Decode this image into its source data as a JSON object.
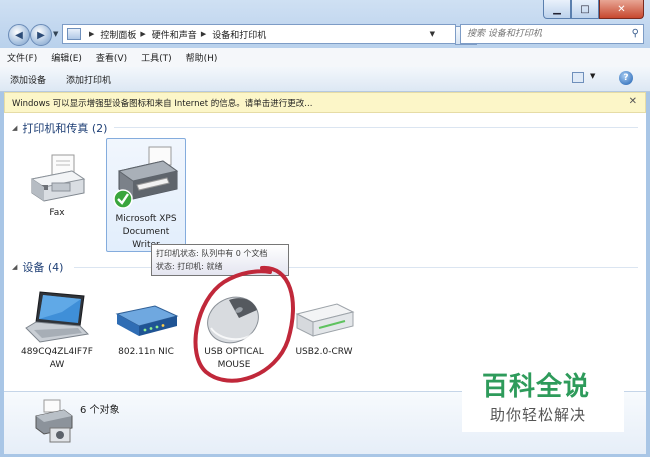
{
  "window": {
    "caption_buttons": {
      "minimize": "▁",
      "maximize": "□",
      "close": "✕"
    }
  },
  "address": {
    "crumbs": [
      "控制面板",
      "硬件和声音",
      "设备和打印机"
    ],
    "search_placeholder": "搜索 设备和打印机"
  },
  "menu": [
    "文件(F)",
    "编辑(E)",
    "查看(V)",
    "工具(T)",
    "帮助(H)"
  ],
  "toolbar": {
    "add_device": "添加设备",
    "add_printer": "添加打印机"
  },
  "infobar": {
    "text": "Windows 可以显示增强型设备图标和来自 Internet 的信息。请单击进行更改..."
  },
  "groups": {
    "printers": {
      "header": "打印机和传真 (2)",
      "items": [
        {
          "label": "Fax",
          "icon": "fax-icon"
        },
        {
          "label": "Microsoft XPS Document Writer",
          "lines": [
            "Microsoft XPS",
            "Document",
            "Writer"
          ],
          "icon": "printer-icon",
          "default": true
        }
      ]
    },
    "devices": {
      "header": "设备 (4)",
      "items": [
        {
          "label": "489CQ4ZL4IF7FAW",
          "lines": [
            "489CQ4ZL4IF7F",
            "AW"
          ],
          "icon": "laptop-icon"
        },
        {
          "label": "802.11n NIC",
          "icon": "router-icon"
        },
        {
          "label": "USB OPTICAL MOUSE",
          "lines": [
            "USB OPTICAL",
            "MOUSE"
          ],
          "icon": "mouse-icon"
        },
        {
          "label": "USB2.0-CRW",
          "icon": "drive-icon"
        }
      ]
    }
  },
  "tooltip": {
    "line1": "打印机状态: 队列中有 0 个文档",
    "line2": "状态: 打印机: 就绪"
  },
  "details": {
    "count": "6 个对象"
  },
  "watermark": {
    "title": "百科全说",
    "subtitle": "助你轻松解决"
  },
  "colors": {
    "accent_green": "#2e9b5b",
    "annotation_red": "#c0283a",
    "infobar_bg": "#fcf6c8"
  }
}
